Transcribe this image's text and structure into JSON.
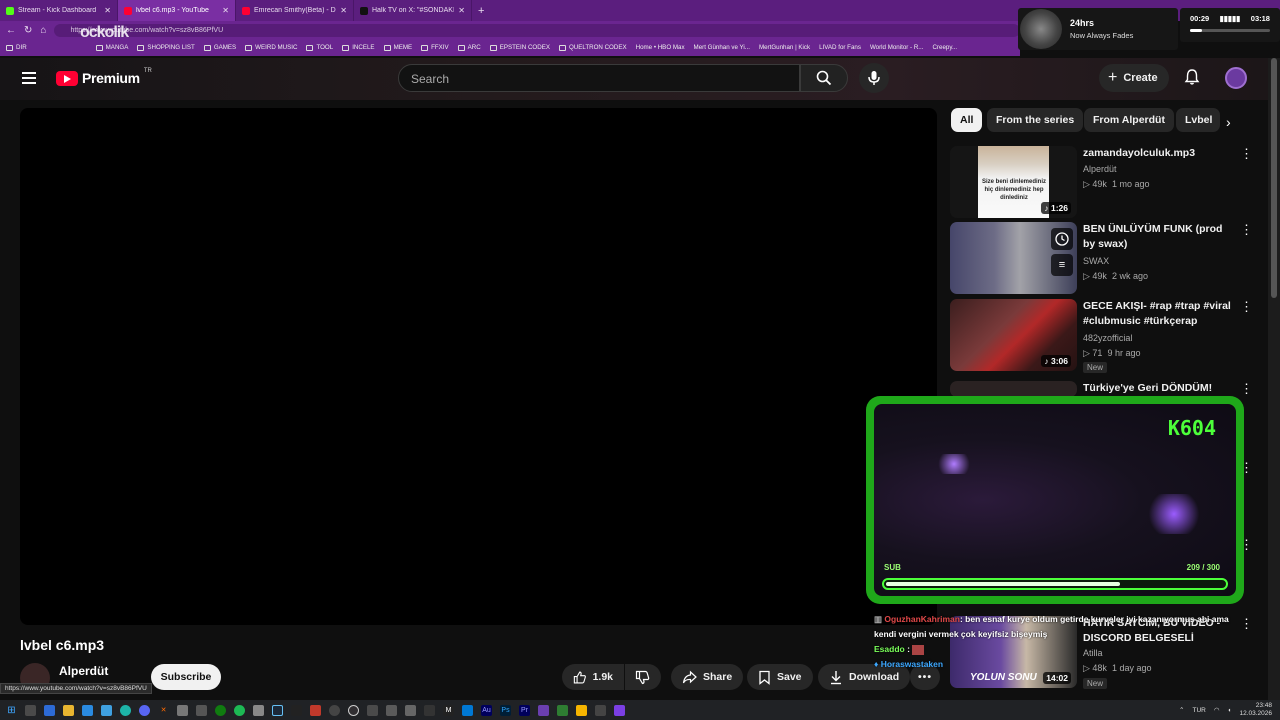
{
  "browser": {
    "tabs": [
      {
        "title": "Stream - Kick Dashboard",
        "color": "#53fc18"
      },
      {
        "title": "lvbel c6.mp3 - YouTube",
        "color": "#ff0033"
      },
      {
        "title": "Emrecan Smithy(Beta) - DirenAVM",
        "color": "#ff0033"
      },
      {
        "title": "Halk TV on X: \"#SONDAKİKA | AKP",
        "color": "#111111"
      }
    ],
    "url": "https://www.youtube.com/watch?v=sz8vB86PfVU",
    "bookmarks": [
      "DIR",
      "MANGA",
      "SHOPPING LIST",
      "GAMES",
      "WEIRD MUSIC",
      "TOOL",
      "INCELE",
      "MEME",
      "FFXIV",
      "ARC",
      "EPSTEIN CODEX",
      "QUELTRON CODEX",
      "Home • HBO Max",
      "Mert Günhan ve Yi...",
      "MertGunhan | Kick",
      "LIVAD for Fans",
      "World Monitor - R...",
      "Creepy..."
    ],
    "overlay_logo": "ockolik"
  },
  "spotify": {
    "track": "24hrs",
    "album": "Now Always Fades",
    "elapsed": "00:29",
    "total": "03:18"
  },
  "youtube": {
    "brand": "Premium",
    "country": "TR",
    "search_placeholder": "Search",
    "create_label": "Create",
    "video_title": "lvbel c6.mp3",
    "channel": "Alperdüt",
    "subscribe": "Subscribe",
    "likes": "1.9k",
    "share": "Share",
    "save": "Save",
    "download": "Download",
    "status_url": "https://www.youtube.com/watch?v=sz8vB86PfVU",
    "chips": [
      "All",
      "From the series",
      "From Alperdüt",
      "Lvbel"
    ],
    "recs": [
      {
        "title": "zamandayolculuk.mp3",
        "channel": "Alperdüt",
        "views": "49k",
        "age": "1 mo ago",
        "duration": "1:26",
        "thumb_text": "Size beni dinlemediniz hiç dinlemediniz hep dinlediniz"
      },
      {
        "title": "BEN ÜNLÜYÜM FUNK (prod by swax)",
        "channel": "SWAX",
        "views": "49k",
        "age": "2 wk ago"
      },
      {
        "title": "GECE AKIŞI-  #rap #trap #viral #clubmusic #türkçerap",
        "channel": "482yzofficial",
        "views": "71",
        "age": "9 hr ago",
        "duration": "3:06",
        "badge": "New"
      },
      {
        "title": "Türkiye'ye Geri DÖNDÜM!"
      },
      {
        "title": "HATIR SAYCIM, BU VİDEO - DISCORD BELGESELİ",
        "channel": "Atilla",
        "views": "48k",
        "age": "1 day ago",
        "duration": "14:02",
        "badge": "New",
        "thumb_text": "YOLUN SONU"
      }
    ]
  },
  "stream": {
    "code": "K604",
    "sub_label": "SUB",
    "sub_count": "209 / 300",
    "sub_progress": 0.697,
    "chat": [
      {
        "user": "OguzhanKahriman",
        "text": ": ben esnaf kurye oldum getirde kurveler iyi kazanıyormuş abi ama kendi vergini vermek çok keyifsiz bişeymiş"
      },
      {
        "user": "Esaddo",
        "text": " :"
      },
      {
        "user": "Horaswastaken",
        "text": ""
      }
    ]
  },
  "taskbar": {
    "lang": "TUR",
    "time": "23:48",
    "date": "12.03.2026"
  }
}
